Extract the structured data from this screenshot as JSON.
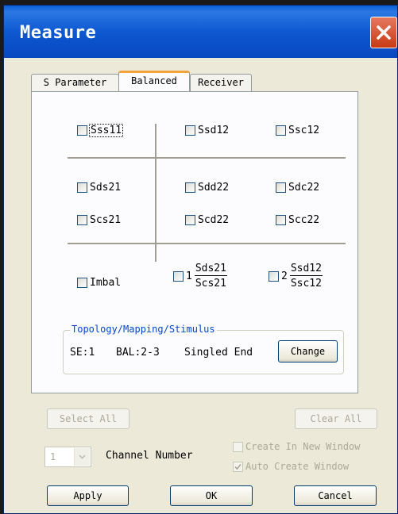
{
  "window": {
    "title": "Measure"
  },
  "tabs": [
    "S Parameter",
    "Balanced",
    "Receiver"
  ],
  "params": {
    "row1": [
      "Sss11",
      "Ssd12",
      "Ssc12"
    ],
    "row2": [
      "Sds21",
      "Sdd22",
      "Sdc22"
    ],
    "row3": [
      "Scs21",
      "Scd22",
      "Scc22"
    ],
    "imbal": "Imbal",
    "ratio1": {
      "prefix": "1",
      "num": "Sds21",
      "den": "Scs21"
    },
    "ratio2": {
      "prefix": "2",
      "num": "Ssd12",
      "den": "Ssc12"
    }
  },
  "topology": {
    "legend": "Topology/Mapping/Stimulus",
    "se": "SE:1",
    "bal": "BAL:2-3",
    "mode": "Singled End",
    "change_label": "Change"
  },
  "bottom": {
    "select_all": "Select All",
    "clear_all": "Clear All",
    "channel_value": "1",
    "channel_label": "Channel Number",
    "create_new_window": "Create In New Window",
    "auto_create_window": "Auto Create Window",
    "apply": "Apply",
    "ok": "OK",
    "cancel": "Cancel"
  }
}
